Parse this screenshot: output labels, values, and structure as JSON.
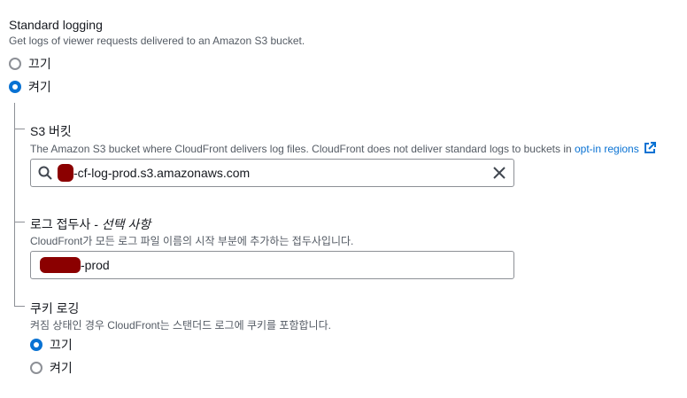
{
  "logging": {
    "title": "Standard logging",
    "description": "Get logs of viewer requests delivered to an Amazon S3 bucket.",
    "options": [
      {
        "label": "끄기",
        "checked": false
      },
      {
        "label": "켜기",
        "checked": true
      }
    ]
  },
  "s3": {
    "label": "S3 버킷",
    "description": "The Amazon S3 bucket where CloudFront delivers log files. CloudFront does not deliver standard logs to buckets in ",
    "link_text": "opt-in regions",
    "value": "-cf-log-prod.s3.amazonaws.com"
  },
  "prefix": {
    "label": "로그 접두사",
    "optional": " - 선택 사항",
    "description": "CloudFront가 모든 로그 파일 이름의 시작 부분에 추가하는 접두사입니다.",
    "value": "-prod"
  },
  "cookie": {
    "label": "쿠키 로깅",
    "description": "켜짐 상태인 경우 CloudFront는 스탠더드 로그에 쿠키를 포함합니다.",
    "options": [
      {
        "label": "끄기",
        "checked": true
      },
      {
        "label": "켜기",
        "checked": false
      }
    ]
  },
  "colors": {
    "accent": "#0972d3",
    "redaction": "#8b0000",
    "border": "#8d9096"
  }
}
